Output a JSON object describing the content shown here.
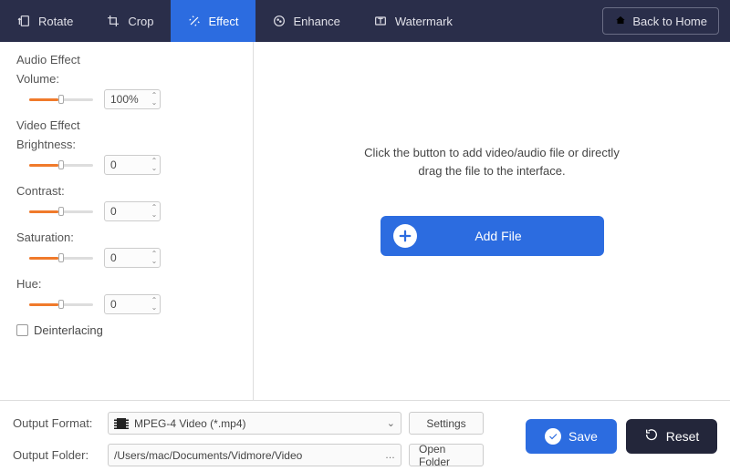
{
  "topbar": {
    "tabs": {
      "rotate": "Rotate",
      "crop": "Crop",
      "effect": "Effect",
      "enhance": "Enhance",
      "watermark": "Watermark"
    },
    "back_home": "Back to Home"
  },
  "sidebar": {
    "audio_section": "Audio Effect",
    "volume_label": "Volume:",
    "volume_value": "100%",
    "video_section": "Video Effect",
    "brightness_label": "Brightness:",
    "brightness_value": "0",
    "contrast_label": "Contrast:",
    "contrast_value": "0",
    "saturation_label": "Saturation:",
    "saturation_value": "0",
    "hue_label": "Hue:",
    "hue_value": "0",
    "deinterlacing_label": "Deinterlacing"
  },
  "dropzone": {
    "line1": "Click the button to add video/audio file or directly",
    "line2": "drag the file to the interface.",
    "add_file": "Add File"
  },
  "bottom": {
    "output_format_label": "Output Format:",
    "output_format_value": "MPEG-4 Video (*.mp4)",
    "settings": "Settings",
    "output_folder_label": "Output Folder:",
    "output_folder_value": "/Users/mac/Documents/Vidmore/Video",
    "open_folder": "Open Folder",
    "save": "Save",
    "reset": "Reset"
  }
}
